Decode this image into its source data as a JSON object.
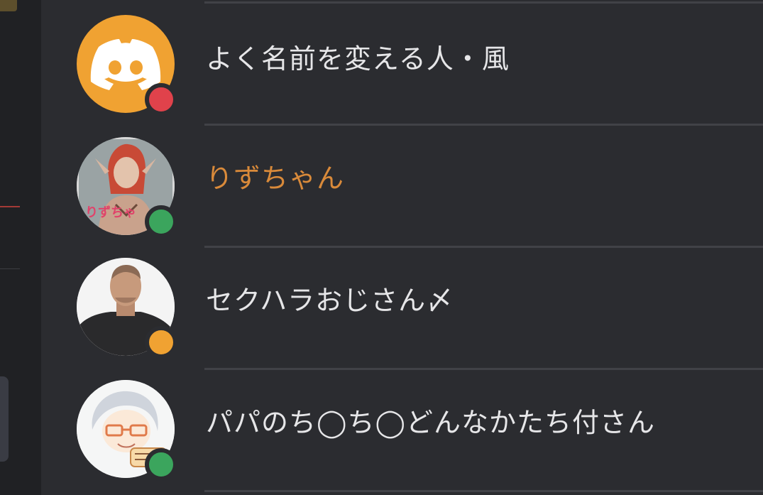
{
  "colors": {
    "background": "#2b2c30",
    "divider": "#414247",
    "name_default": "#e6e6e8",
    "name_highlight": "#d98a3a",
    "status_dnd": "#e0424b",
    "status_online": "#3ba55d",
    "status_idle": "#f0a232",
    "discord_default_avatar": "#f0a232"
  },
  "members": [
    {
      "name": "よく名前を変える人・風",
      "avatar": "discord-logo-icon",
      "status": "dnd",
      "name_color": "#e6e6e8"
    },
    {
      "name": "りずちゃん",
      "avatar": "anime-character-avatar",
      "status": "online",
      "name_color": "#d98a3a"
    },
    {
      "name": "セクハラおじさん〆",
      "avatar": "man-photo-avatar",
      "status": "idle",
      "name_color": "#e6e6e8"
    },
    {
      "name": "パパのち◯ち◯どんなかたち付さん",
      "avatar": "chibi-illustration-avatar",
      "status": "online",
      "name_color": "#e6e6e8"
    }
  ]
}
